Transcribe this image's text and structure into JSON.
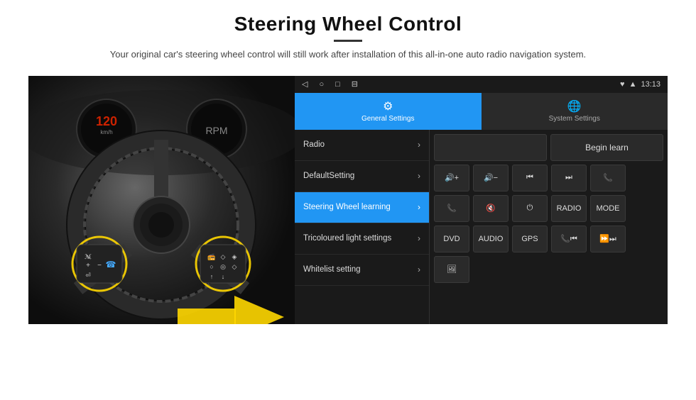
{
  "header": {
    "title": "Steering Wheel Control",
    "divider": true,
    "subtitle": "Your original car's steering wheel control will still work after installation of this all-in-one auto radio navigation system."
  },
  "android": {
    "statusbar": {
      "nav_icons": [
        "◁",
        "○",
        "□",
        "⊟"
      ],
      "status_icons": [
        "♥",
        "▲",
        "13:13"
      ]
    },
    "tabs": [
      {
        "label": "General Settings",
        "icon": "⚙",
        "active": true
      },
      {
        "label": "System Settings",
        "icon": "🌐",
        "active": false
      }
    ],
    "menu_items": [
      {
        "label": "Radio",
        "active": false
      },
      {
        "label": "DefaultSetting",
        "active": false
      },
      {
        "label": "Steering Wheel learning",
        "active": true
      },
      {
        "label": "Tricoloured light settings",
        "active": false
      },
      {
        "label": "Whitelist setting",
        "active": false
      }
    ],
    "controls": {
      "begin_learn": "Begin learn",
      "row1": [
        "🔊+",
        "🔊-",
        "⏮",
        "⏭",
        "📞"
      ],
      "row2": [
        "📞",
        "🔇",
        "⏻",
        "RADIO",
        "MODE"
      ],
      "row3": [
        "DVD",
        "AUDIO",
        "GPS",
        "📞⏮",
        "⏩⏭"
      ],
      "row4": [
        "🖼"
      ]
    }
  }
}
